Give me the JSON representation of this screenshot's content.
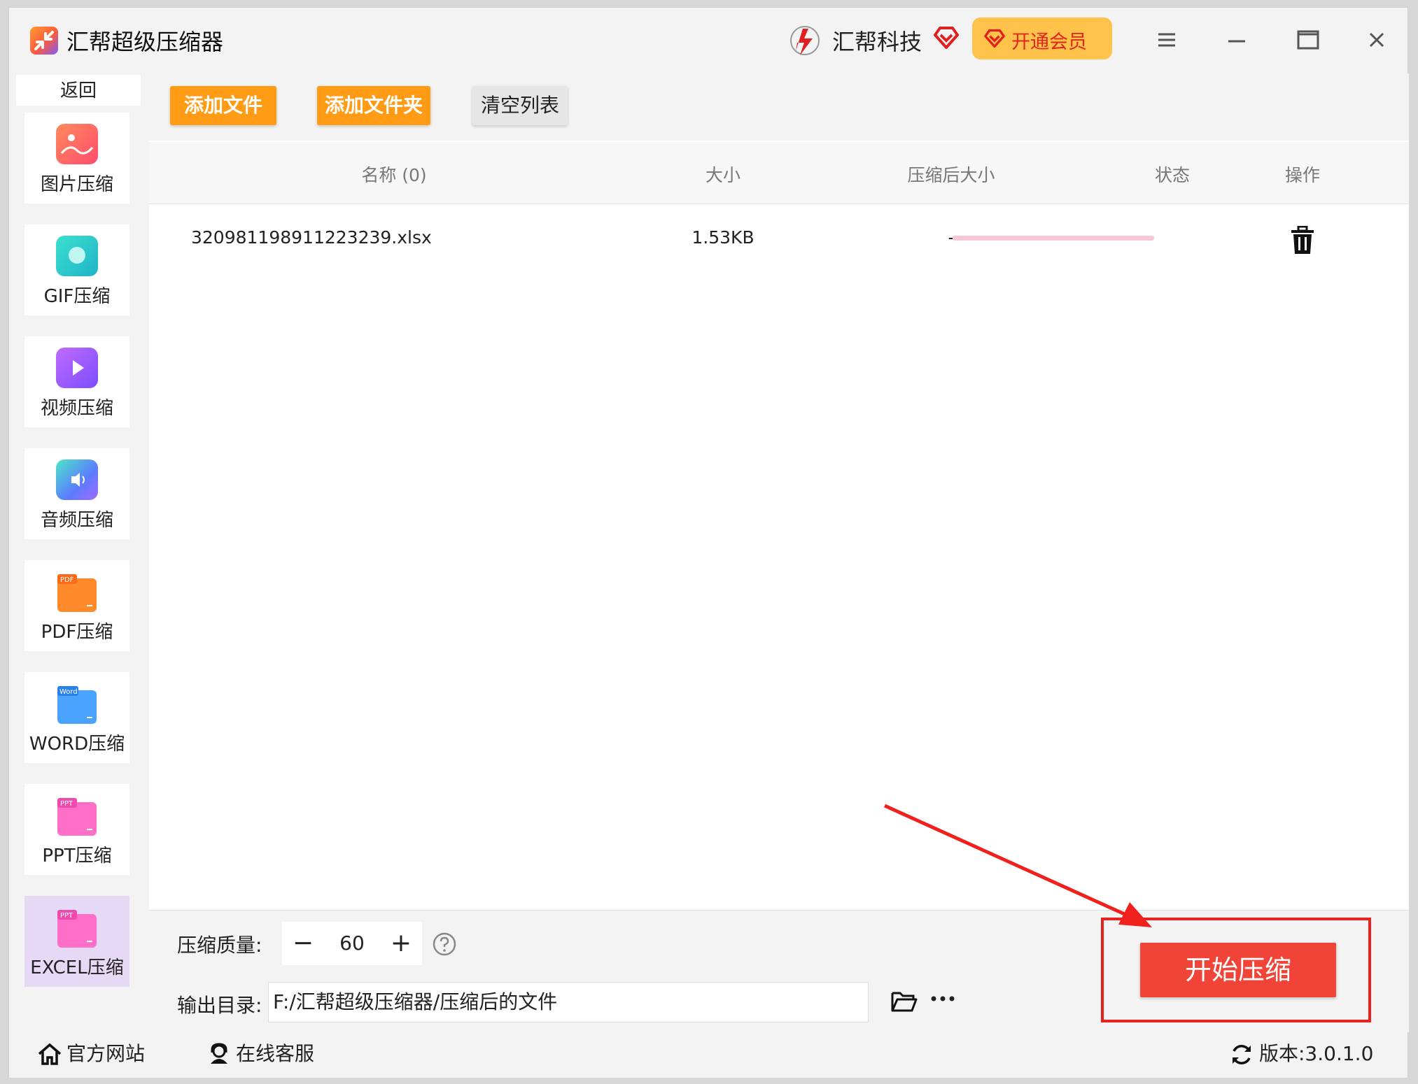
{
  "app": {
    "title": "汇帮超级压缩器",
    "brand_name": "汇帮科技",
    "vip_label": "开通会员"
  },
  "sidebar": {
    "back_label": "返回",
    "items": [
      {
        "label": "图片压缩",
        "icon": "image-icon"
      },
      {
        "label": "GIF压缩",
        "icon": "gif-icon"
      },
      {
        "label": "视频压缩",
        "icon": "video-icon"
      },
      {
        "label": "音频压缩",
        "icon": "audio-icon"
      },
      {
        "label": "PDF压缩",
        "icon": "pdf-file-icon",
        "badge": "PDF"
      },
      {
        "label": "WORD压缩",
        "icon": "word-file-icon",
        "badge": "Word"
      },
      {
        "label": "PPT压缩",
        "icon": "ppt-file-icon",
        "badge": "PPT"
      },
      {
        "label": "EXCEL压缩",
        "icon": "excel-file-icon",
        "badge": "PPT",
        "active": true
      }
    ]
  },
  "toolbar": {
    "add_file": "添加文件",
    "add_folder": "添加文件夹",
    "clear_list": "清空列表"
  },
  "table": {
    "headers": [
      "名称 (0)",
      "大小",
      "压缩后大小",
      "状态",
      "操作"
    ],
    "rows": [
      {
        "name": "320981198911223239.xlsx",
        "size": "1.53KB",
        "compressed_size": "-",
        "status_progress": 0
      }
    ]
  },
  "settings": {
    "quality_label": "压缩质量:",
    "quality_value": "60",
    "output_label": "输出目录:",
    "output_path": "F:/汇帮超级压缩器/压缩后的文件",
    "start_label": "开始压缩"
  },
  "footer": {
    "website": "官方网站",
    "support": "在线客服",
    "version": "版本:3.0.1.0"
  },
  "colors": {
    "accent_orange": "#ff9b14",
    "start_red": "#f04438",
    "highlight_red": "#e8221f",
    "vip_yellow": "#ffc24a"
  }
}
